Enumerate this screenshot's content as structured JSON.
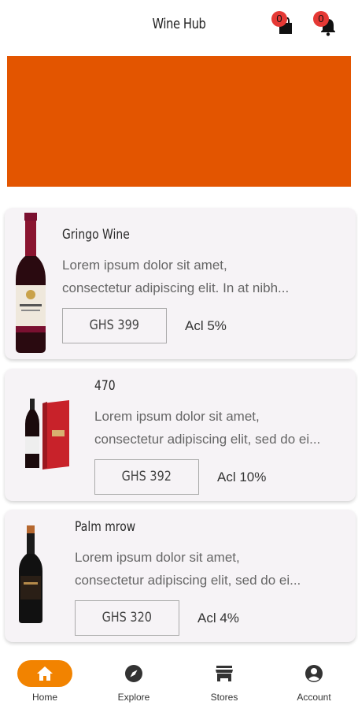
{
  "header": {
    "title": "Wine Hub",
    "cart_count": "0",
    "notification_count": "0"
  },
  "colors": {
    "accent": "#f28300",
    "banner": "#e35500",
    "badge": "#e53935"
  },
  "products": [
    {
      "name": "Gringo Wine",
      "description_line1": "Lorem ipsum dolor sit amet,",
      "description_line2": "consectetur adipiscing elit. In at nibh...",
      "price": "GHS 399",
      "acl": "Acl 5%"
    },
    {
      "name": "470",
      "description_line1": "Lorem ipsum dolor sit amet,",
      "description_line2": "consectetur adipiscing elit, sed do ei...",
      "price": "GHS 392",
      "acl": "Acl 10%"
    },
    {
      "name": "Palm mrow",
      "description_line1": "Lorem ipsum dolor sit amet,",
      "description_line2": "consectetur adipiscing elit, sed do ei...",
      "price": "GHS 320",
      "acl": "Acl 4%"
    }
  ],
  "nav": {
    "items": [
      {
        "label": "Home",
        "icon": "home-icon",
        "active": true
      },
      {
        "label": "Explore",
        "icon": "compass-icon",
        "active": false
      },
      {
        "label": "Stores",
        "icon": "store-icon",
        "active": false
      },
      {
        "label": "Account",
        "icon": "account-icon",
        "active": false
      }
    ]
  }
}
